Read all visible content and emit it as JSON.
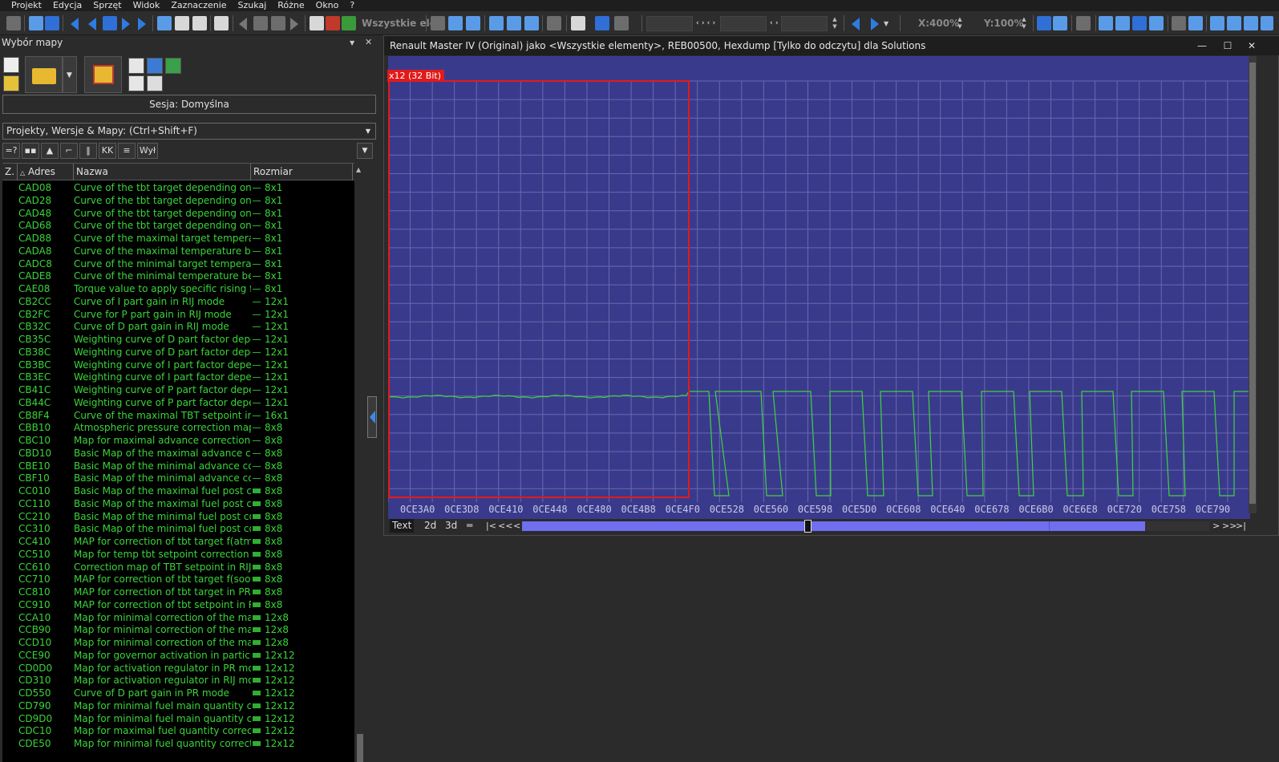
{
  "menu": [
    "Projekt",
    "Edycja",
    "Sprzęt",
    "Widok",
    "Zaznaczenie",
    "Szukaj",
    "Różne",
    "Okno",
    "?"
  ],
  "toolbar": {
    "selection_text": "Wszystkie ele",
    "zoom_x": "X:400%",
    "zoom_y": "Y:100%"
  },
  "left_panel": {
    "title": "Wybór mapy",
    "session": "Sesja: Domyślna",
    "project_box": "Projekty, Wersje & Mapy:  (Ctrl+Shift+F)",
    "filter_label": "Wył",
    "columns": [
      "Z.",
      "Adres",
      "Nazwa",
      "Rozmiar"
    ],
    "rows": [
      {
        "addr": "CAD08",
        "name": "Curve of the tbt target depending on th",
        "size": "8x1",
        "icon": "line"
      },
      {
        "addr": "CAD28",
        "name": "Curve of the tbt target depending on th",
        "size": "8x1",
        "icon": "line"
      },
      {
        "addr": "CAD48",
        "name": "Curve of the tbt target depending on th",
        "size": "8x1",
        "icon": "line"
      },
      {
        "addr": "CAD68",
        "name": "Curve of the tbt target depending on th",
        "size": "8x1",
        "icon": "line"
      },
      {
        "addr": "CAD88",
        "name": "Curve of the maximal target temperature",
        "size": "8x1",
        "icon": "line"
      },
      {
        "addr": "CADA8",
        "name": "Curve of the maximal temperature before",
        "size": "8x1",
        "icon": "line"
      },
      {
        "addr": "CADC8",
        "name": "Curve of the minimal target temperature",
        "size": "8x1",
        "icon": "line"
      },
      {
        "addr": "CADE8",
        "name": "Curve of the minimal temperature before",
        "size": "8x1",
        "icon": "line"
      },
      {
        "addr": "CAE08",
        "name": "Torque value to apply specific rising facto",
        "size": "8x1",
        "icon": "line"
      },
      {
        "addr": "CB2CC",
        "name": "Curve of I part gain in RIJ mode",
        "size": "12x1",
        "icon": "line"
      },
      {
        "addr": "CB2FC",
        "name": "Curve for P part gain in RIJ mode",
        "size": "12x1",
        "icon": "line"
      },
      {
        "addr": "CB32C",
        "name": "Curve of D part gain in RIJ mode",
        "size": "12x1",
        "icon": "line"
      },
      {
        "addr": "CB35C",
        "name": "Weighting curve of D part factor depend",
        "size": "12x1",
        "icon": "line"
      },
      {
        "addr": "CB38C",
        "name": "Weighting curve of D part factor depend",
        "size": "12x1",
        "icon": "line"
      },
      {
        "addr": "CB3BC",
        "name": "Weighting curve of I part factor dependi",
        "size": "12x1",
        "icon": "line"
      },
      {
        "addr": "CB3EC",
        "name": "Weighting curve of I part factor dependi",
        "size": "12x1",
        "icon": "line"
      },
      {
        "addr": "CB41C",
        "name": "Weighting curve of P part factor depend",
        "size": "12x1",
        "icon": "line"
      },
      {
        "addr": "CB44C",
        "name": "Weighting curve of P part factor depend",
        "size": "12x1",
        "icon": "line"
      },
      {
        "addr": "CB8F4",
        "name": "Curve of the maximal TBT setpoint in PF",
        "size": "16x1",
        "icon": "line"
      },
      {
        "addr": "CBB10",
        "name": "Atmospheric pressure correction map for",
        "size": "8x8",
        "icon": "line"
      },
      {
        "addr": "CBC10",
        "name": "Map for maximal advance correction in PR",
        "size": "8x8",
        "icon": "line"
      },
      {
        "addr": "CBD10",
        "name": "Basic Map of the maximal advance correct",
        "size": "8x8",
        "icon": "line"
      },
      {
        "addr": "CBE10",
        "name": "Basic Map of the minimal advance correct",
        "size": "8x8",
        "icon": "line"
      },
      {
        "addr": "CBF10",
        "name": "Basic Map of the minimal advance correct",
        "size": "8x8",
        "icon": "line"
      },
      {
        "addr": "CC010",
        "name": "Basic Map of the maximal fuel post correc",
        "size": "8x8",
        "icon": "block"
      },
      {
        "addr": "CC110",
        "name": "Basic Map of the maximal fuel post correc",
        "size": "8x8",
        "icon": "block"
      },
      {
        "addr": "CC210",
        "name": "Basic Map of the minimal fuel post correct",
        "size": "8x8",
        "icon": "block"
      },
      {
        "addr": "CC310",
        "name": "Basic Map of the minimal fuel post correct",
        "size": "8x8",
        "icon": "block"
      },
      {
        "addr": "CC410",
        "name": "MAP for correction of tbt target f(atmo p",
        "size": "8x8",
        "icon": "block"
      },
      {
        "addr": "CC510",
        "name": "Map for temp tbt setpoint correction f(sc",
        "size": "8x8",
        "icon": "block"
      },
      {
        "addr": "CC610",
        "name": "Correction map of TBT setpoint in RIJ mo",
        "size": "8x8",
        "icon": "block"
      },
      {
        "addr": "CC710",
        "name": "MAP for correction of tbt target f(soot m",
        "size": "8x8",
        "icon": "block"
      },
      {
        "addr": "CC810",
        "name": "MAP for correction of tbt target in PR mo",
        "size": "8x8",
        "icon": "block"
      },
      {
        "addr": "CC910",
        "name": "MAP for correction of tbt setpoint in RIJ",
        "size": "8x8",
        "icon": "block"
      },
      {
        "addr": "CCA10",
        "name": "Map for minimal correction of the max inr",
        "size": "12x8",
        "icon": "block"
      },
      {
        "addr": "CCB90",
        "name": "Map for minimal correction of the max inr",
        "size": "12x8",
        "icon": "block"
      },
      {
        "addr": "CCD10",
        "name": "Map for minimal correction of the max inr",
        "size": "12x8",
        "icon": "block"
      },
      {
        "addr": "CCE90",
        "name": "Map for governor activation in particulate",
        "size": "12x12",
        "icon": "block"
      },
      {
        "addr": "CD0D0",
        "name": "Map for activation regulator in PR mode",
        "size": "12x12",
        "icon": "block"
      },
      {
        "addr": "CD310",
        "name": "Map for activation regulator in RIJ mode",
        "size": "12x12",
        "icon": "block"
      },
      {
        "addr": "CD550",
        "name": "Curve of D part gain in PR mode",
        "size": "12x12",
        "icon": "block"
      },
      {
        "addr": "CD790",
        "name": "Map for minimal fuel main quantity correc",
        "size": "12x12",
        "icon": "block"
      },
      {
        "addr": "CD9D0",
        "name": "Map for minimal fuel main quantity correc",
        "size": "12x12",
        "icon": "block"
      },
      {
        "addr": "CDC10",
        "name": "Map for maximal fuel quantity correction",
        "size": "12x12",
        "icon": "block"
      },
      {
        "addr": "CDE50",
        "name": "Map for minimal fuel quantity correction c",
        "size": "12x12",
        "icon": "block"
      }
    ]
  },
  "map_window": {
    "title": "Renault Master IV (Original) jako <Wszystkie elementy>, REB00500, Hexdump   [Tylko do odczytu] dla Solutions",
    "selection_label": "x12 (32 Bit)",
    "x_ticks": [
      "0CE3A0",
      "0CE3D8",
      "0CE410",
      "0CE448",
      "0CE480",
      "0CE4B8",
      "0CE4F0",
      "0CE528",
      "0CE560",
      "0CE598",
      "0CE5D0",
      "0CE608",
      "0CE640",
      "0CE678",
      "0CE6B0",
      "0CE6E8",
      "0CE720",
      "0CE758",
      "0CE790"
    ],
    "tabs": [
      "Text",
      "2d",
      "3d"
    ],
    "nav": [
      "|<",
      "<<",
      "<",
      ">",
      ">>",
      ">|"
    ],
    "colors": {
      "plot_bg": "#3a3a8c",
      "grid": "#6868b0",
      "line": "#3ed43e",
      "selection": "#e21a1a"
    }
  }
}
